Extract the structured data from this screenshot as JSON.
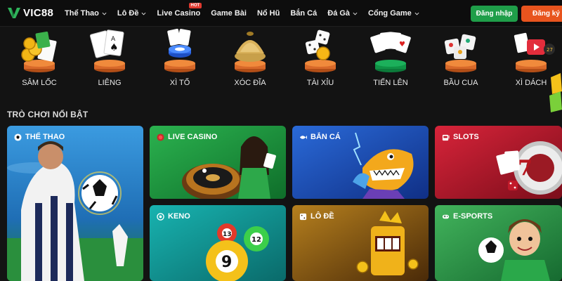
{
  "brand": {
    "name": "VIC88"
  },
  "nav": {
    "items": [
      {
        "label": "Thể Thao",
        "dropdown": true
      },
      {
        "label": "Lô Đề",
        "dropdown": true
      },
      {
        "label": "Live Casino",
        "dropdown": false,
        "badge": "HOT"
      },
      {
        "label": "Game Bài",
        "dropdown": false
      },
      {
        "label": "Nổ Hũ",
        "dropdown": false
      },
      {
        "label": "Bắn Cá",
        "dropdown": false
      },
      {
        "label": "Đá Gà",
        "dropdown": true
      },
      {
        "label": "Cổng Game",
        "dropdown": true
      }
    ],
    "login_label": "Đăng nhập",
    "register_label": "Đăng ký"
  },
  "games": [
    {
      "label": "SÂM LỐC",
      "icon": "sam-loc-icon"
    },
    {
      "label": "LIÊNG",
      "icon": "lieng-icon"
    },
    {
      "label": "XÌ TỐ",
      "icon": "xi-to-icon"
    },
    {
      "label": "XÓC ĐĨA",
      "icon": "xoc-dia-icon"
    },
    {
      "label": "TÀI XỈU",
      "icon": "tai-xiu-icon"
    },
    {
      "label": "TIẾN LÊN",
      "icon": "tien-len-icon"
    },
    {
      "label": "BẦU CUA",
      "icon": "bau-cua-icon"
    },
    {
      "label": "XÌ DÁCH",
      "icon": "xi-dach-icon"
    }
  ],
  "featured": {
    "title": "TRÒ CHƠI NỔI BẬT",
    "cards": [
      {
        "label": "THỂ THAO",
        "icon": "soccer-ball-icon"
      },
      {
        "label": "LIVE CASINO",
        "icon": "live-dot-icon"
      },
      {
        "label": "BẮN CÁ",
        "icon": "fish-icon"
      },
      {
        "label": "SLOTS",
        "icon": "slot-machine-icon"
      },
      {
        "label": "KENO",
        "icon": "keno-icon"
      },
      {
        "label": "LÔ ĐỀ",
        "icon": "dice-icon"
      },
      {
        "label": "E-SPORTS",
        "icon": "gamepad-icon"
      }
    ]
  },
  "colors": {
    "background": "#131313",
    "header": "#0d0d0d",
    "login": "#1f9e49",
    "register": "#e8541e",
    "hot": "#e03a2f",
    "sports_card": "#2a7ec4",
    "casino_card": "#1f9a3e",
    "fish_card": "#1c4fb0",
    "slots_card": "#c4172b",
    "keno_card": "#0e8c8c",
    "lode_card": "#8a5a12",
    "esports_card": "#2d8a4a"
  }
}
